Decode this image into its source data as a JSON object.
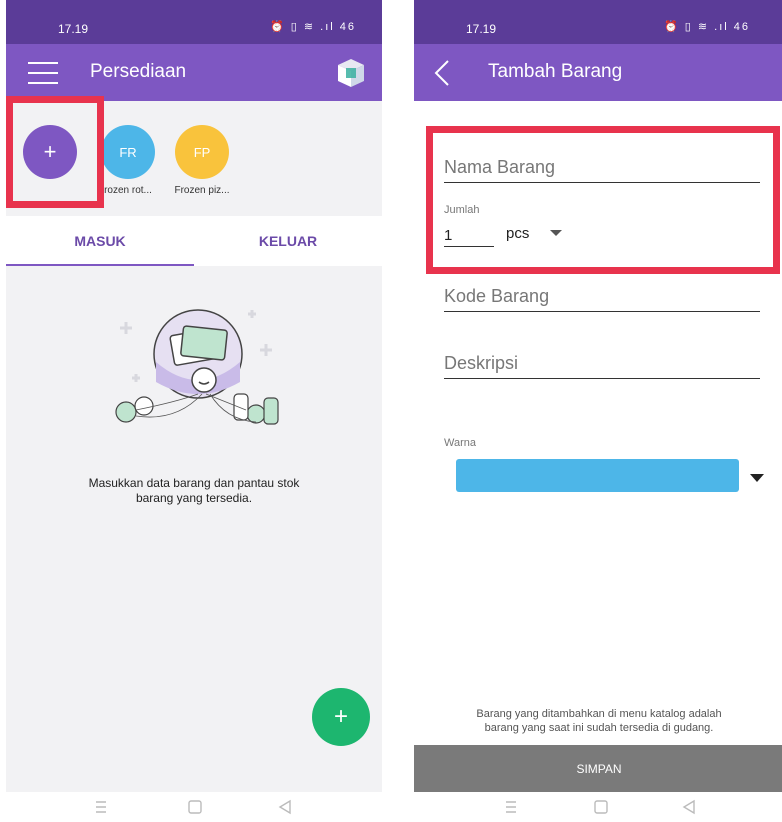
{
  "left_screen": {
    "status": {
      "time": "17.19",
      "icons_text": "⏰ ▯ ≋ .ıl 46"
    },
    "header": {
      "title": "Persediaan"
    },
    "stock_items": [
      {
        "initials": "+",
        "label": "",
        "color": "#7e57c2"
      },
      {
        "initials": "FR",
        "label": "rozen rot...",
        "color": "#4db6e8"
      },
      {
        "initials": "FP",
        "label": "Frozen piz...",
        "color": "#f9c33c"
      }
    ],
    "tabs": [
      {
        "label": "MASUK",
        "active": true
      },
      {
        "label": "KELUAR",
        "active": false
      }
    ],
    "empty_state": {
      "line1": "Masukkan data barang dan pantau stok",
      "line2": "barang yang tersedia."
    },
    "fab": {
      "label": "+"
    }
  },
  "right_screen": {
    "status": {
      "time": "17.19",
      "icons_text": "⏰ ▯ ≋ .ıl 46"
    },
    "header": {
      "title": "Tambah Barang"
    },
    "form": {
      "name_placeholder": "Nama Barang",
      "qty_label": "Jumlah",
      "qty_value": "1",
      "unit_value": "pcs",
      "code_placeholder": "Kode Barang",
      "desc_placeholder": "Deskripsi",
      "color_label": "Warna",
      "color_value": "#4db6e8"
    },
    "note": {
      "line1": "Barang yang ditambahkan di menu katalog adalah",
      "line2": "barang yang saat ini sudah tersedia di gudang."
    },
    "save_label": "SIMPAN"
  },
  "colors": {
    "status_bar": "#5b3c98",
    "app_bar": "#7e57c2",
    "highlight": "#e8334d",
    "fab": "#1db66f",
    "save_button": "#7a7a7a"
  }
}
